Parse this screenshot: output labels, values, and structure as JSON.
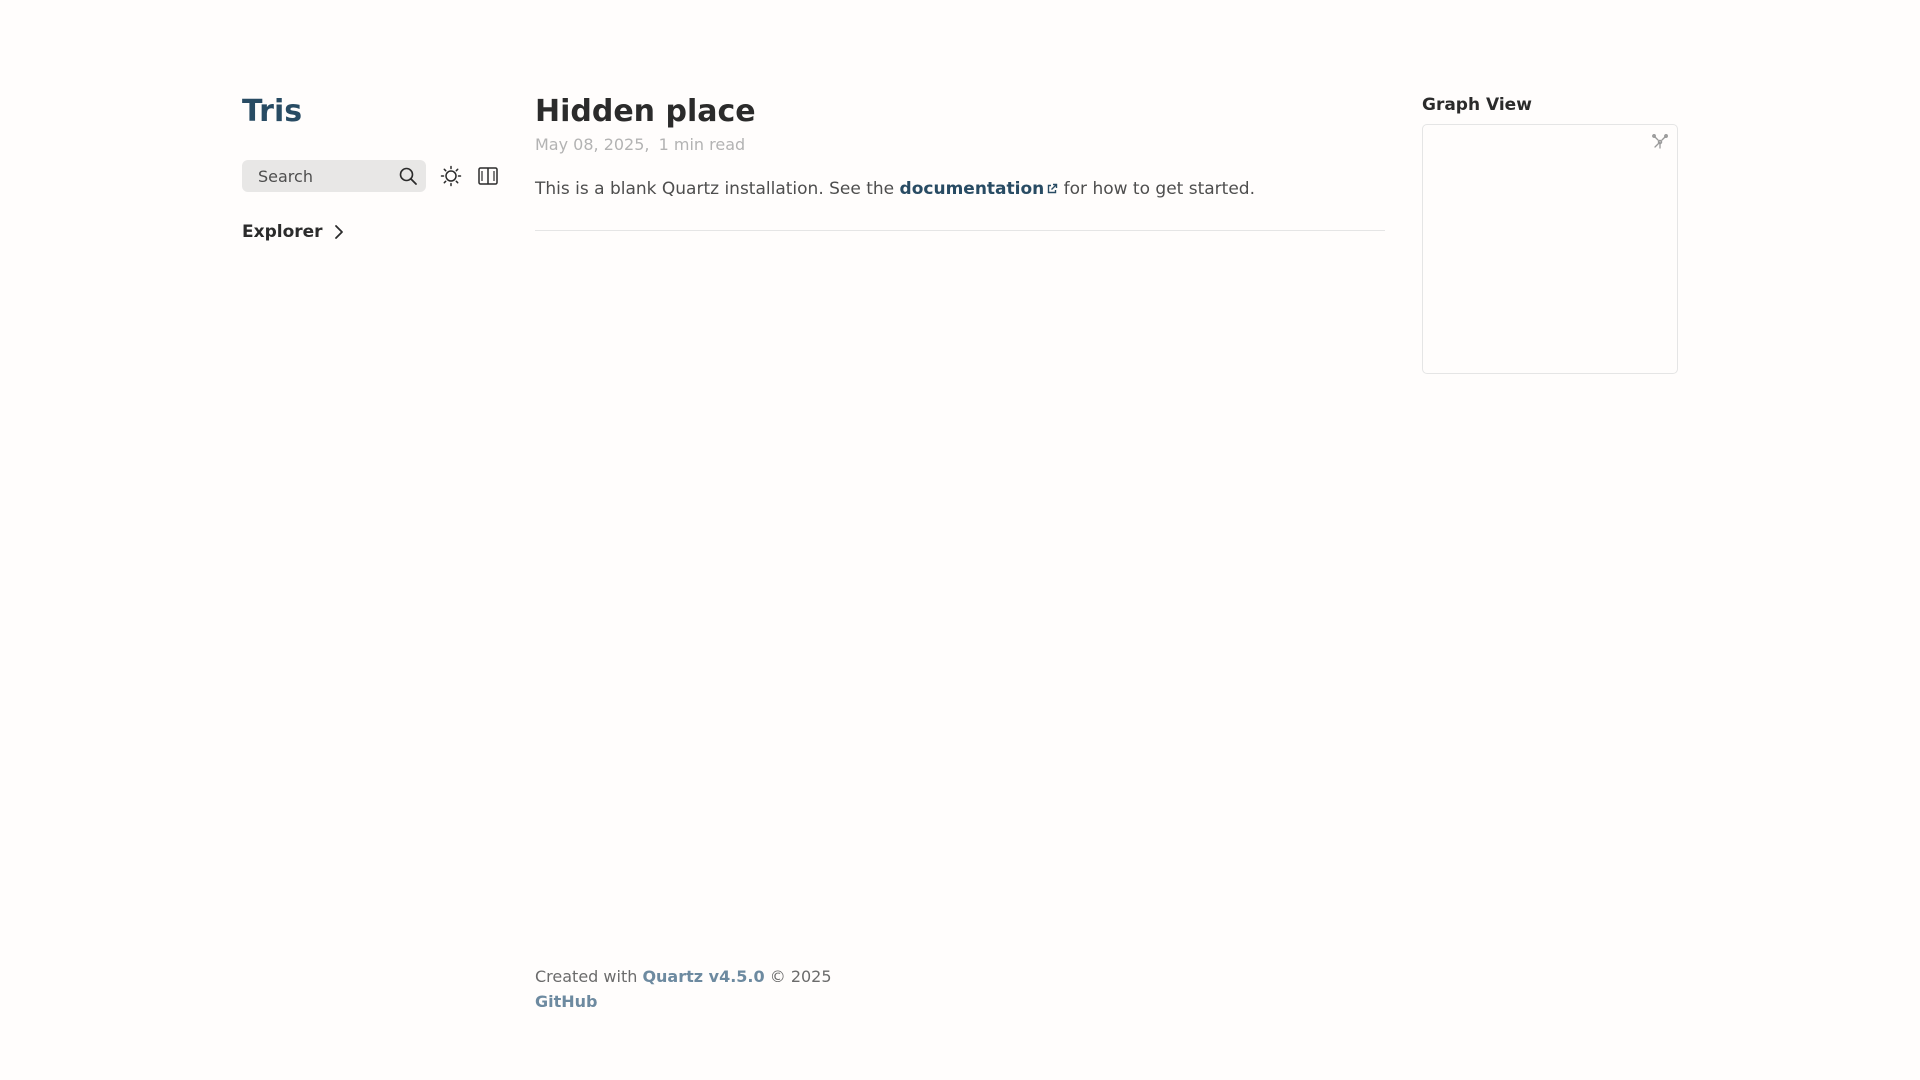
{
  "sidebar": {
    "site_title": "Tris",
    "search": {
      "label": "Search",
      "icon": "search-icon"
    },
    "theme_toggle_icon": "sun-icon",
    "reader_mode_icon": "book-icon",
    "explorer": {
      "label": "Explorer",
      "icon": "chevron-right-icon"
    }
  },
  "article": {
    "title": "Hidden place",
    "date": "May 08, 2025",
    "separator": ",",
    "read_time": "1 min read",
    "body_prefix": "This is a blank Quartz installation. See the ",
    "link_text": "documentation",
    "body_suffix": " for how to get started."
  },
  "graph": {
    "title": "Graph View",
    "expand_icon": "expand-graph-icon"
  },
  "footer": {
    "created_with": "Created with ",
    "quartz_link": "Quartz v4.5.0",
    "copyright": " © 2025",
    "github_link": "GitHub"
  },
  "colors": {
    "accent": "#284b63",
    "background": "#fffdfc",
    "muted_text": "#b3b3b3",
    "footer_link": "#6d8aa0",
    "search_bg": "#e8e7e6"
  }
}
